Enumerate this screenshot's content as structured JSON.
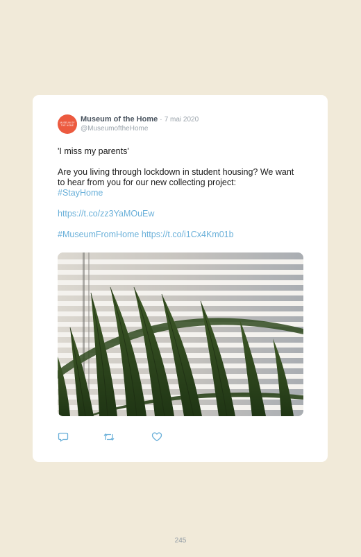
{
  "avatar": {
    "line1": "MUSEUM OF",
    "line2": "THE HOME",
    "color": "#ec5a3f"
  },
  "tweet": {
    "author_name": "Museum of the Home",
    "separator": "·",
    "date": "7 mai 2020",
    "handle": "@MuseumoftheHome",
    "quote": "'I miss my parents'",
    "body": "Are you living through lockdown in student housing? We want to hear from you for our new collecting project:",
    "hashtag_stayhome": "#StayHome",
    "link_1": "https://t.co/zz3YaMOuEw",
    "hashtag_museum": "#MuseumFromHome",
    "link_2": "https://t.co/i1Cx4Km01b"
  },
  "actions": {
    "reply_icon": "reply-icon",
    "retweet_icon": "retweet-icon",
    "like_icon": "heart-icon"
  },
  "colors": {
    "page_background": "#f1ead9",
    "link": "#6ab0d9",
    "icon": "#6ab0d9"
  },
  "page_number": "245"
}
